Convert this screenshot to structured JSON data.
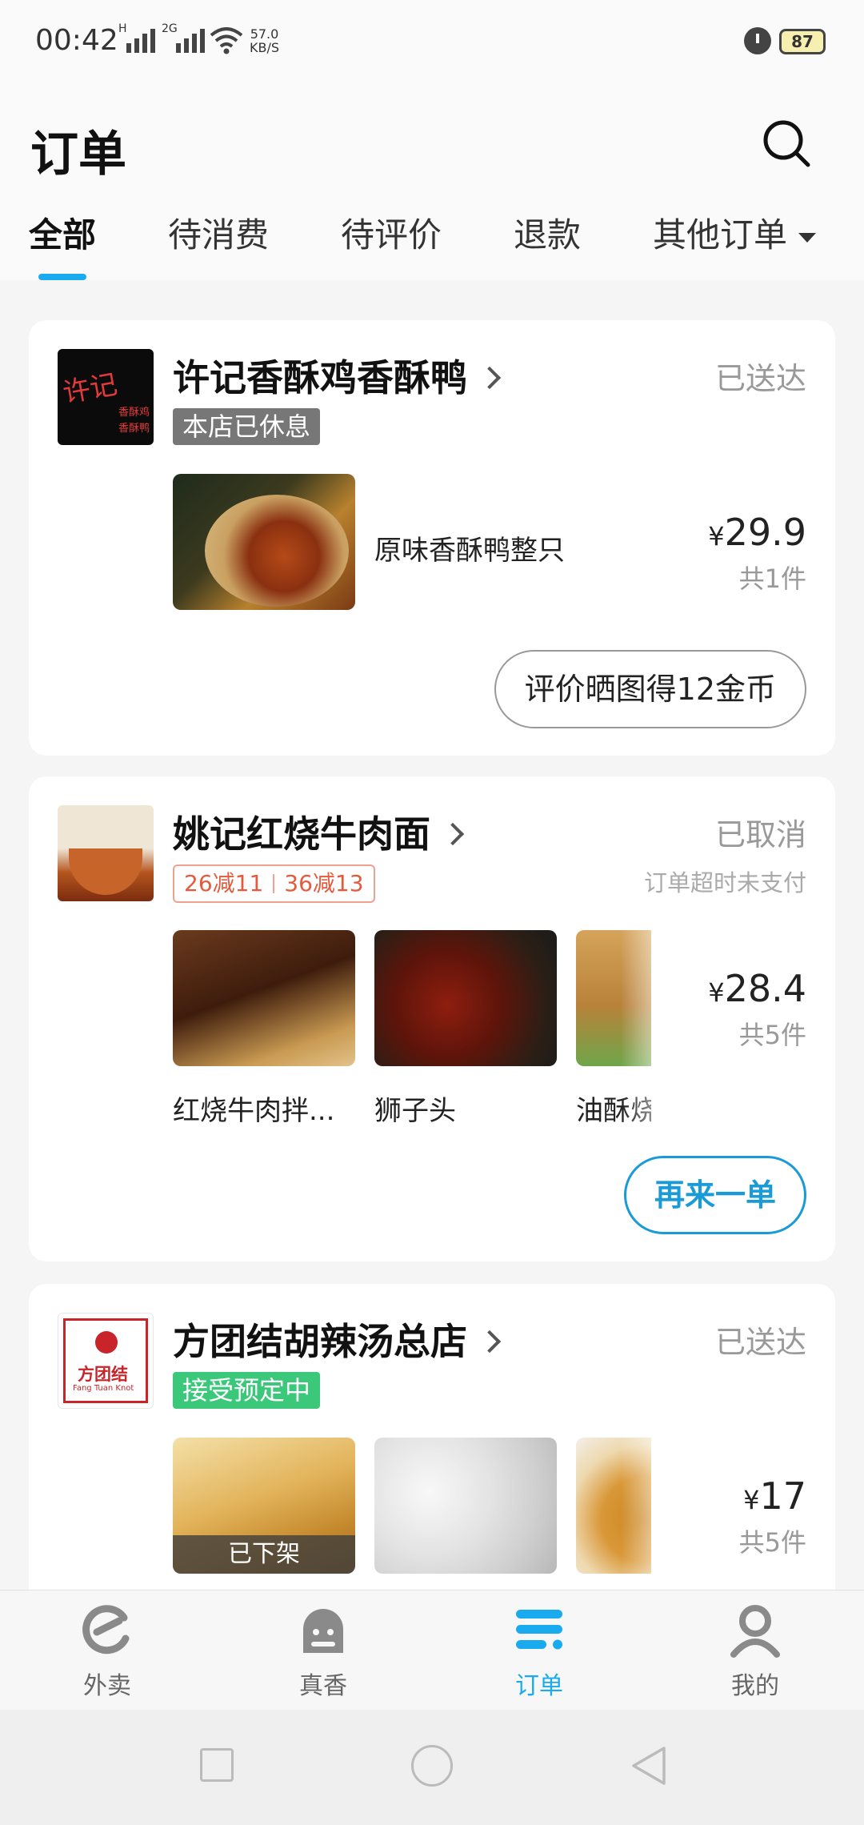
{
  "status_bar": {
    "time": "00:42",
    "sig1_label": "H",
    "sig2_label": "2G",
    "speed_value": "57.0",
    "speed_unit": "KB/S",
    "battery": "87"
  },
  "header": {
    "title": "订单",
    "search_icon": "search-icon"
  },
  "tabs": [
    {
      "label": "全部",
      "active": true
    },
    {
      "label": "待消费"
    },
    {
      "label": "待评价"
    },
    {
      "label": "退款"
    },
    {
      "label": "其他订单"
    }
  ],
  "orders": [
    {
      "shop_name": "许记香酥鸡香酥鸭",
      "logo_text": "许记",
      "logo_subtext_1": "香酥鸡",
      "logo_subtext_2": "香酥鸭",
      "status": "已送达",
      "badge": "本店已休息",
      "items": [
        {
          "name": "原味香酥鸭整只"
        }
      ],
      "price_symbol": "¥",
      "price": "29.9",
      "count": "共1件",
      "action": "评价晒图得12金币"
    },
    {
      "shop_name": "姚记红烧牛肉面",
      "status": "已取消",
      "substatus": "订单超时未支付",
      "promos": [
        "26减11",
        "36减13"
      ],
      "items": [
        {
          "name": "红烧牛肉拌..."
        },
        {
          "name": "狮子头"
        },
        {
          "name": "油酥烧"
        }
      ],
      "price_symbol": "¥",
      "price": "28.4",
      "count": "共5件",
      "action": "再来一单"
    },
    {
      "shop_name": "方团结胡辣汤总店",
      "logo_text": "方团结",
      "logo_subtext": "Fang Tuan Knot",
      "status": "已送达",
      "badge": "接受预定中",
      "items": [
        {
          "overlay": "已下架"
        },
        {},
        {}
      ],
      "price_symbol": "¥",
      "price": "17",
      "count": "共5件"
    }
  ],
  "bottom_nav": [
    {
      "label": "外卖",
      "icon": "waimai-icon"
    },
    {
      "label": "真香",
      "icon": "zhenxiang-icon"
    },
    {
      "label": "订单",
      "icon": "orders-icon",
      "active": true
    },
    {
      "label": "我的",
      "icon": "profile-icon"
    }
  ],
  "colors": {
    "accent": "#1aaaf0",
    "promo_red": "#e55a3c",
    "badge_green": "#3bc87a"
  }
}
